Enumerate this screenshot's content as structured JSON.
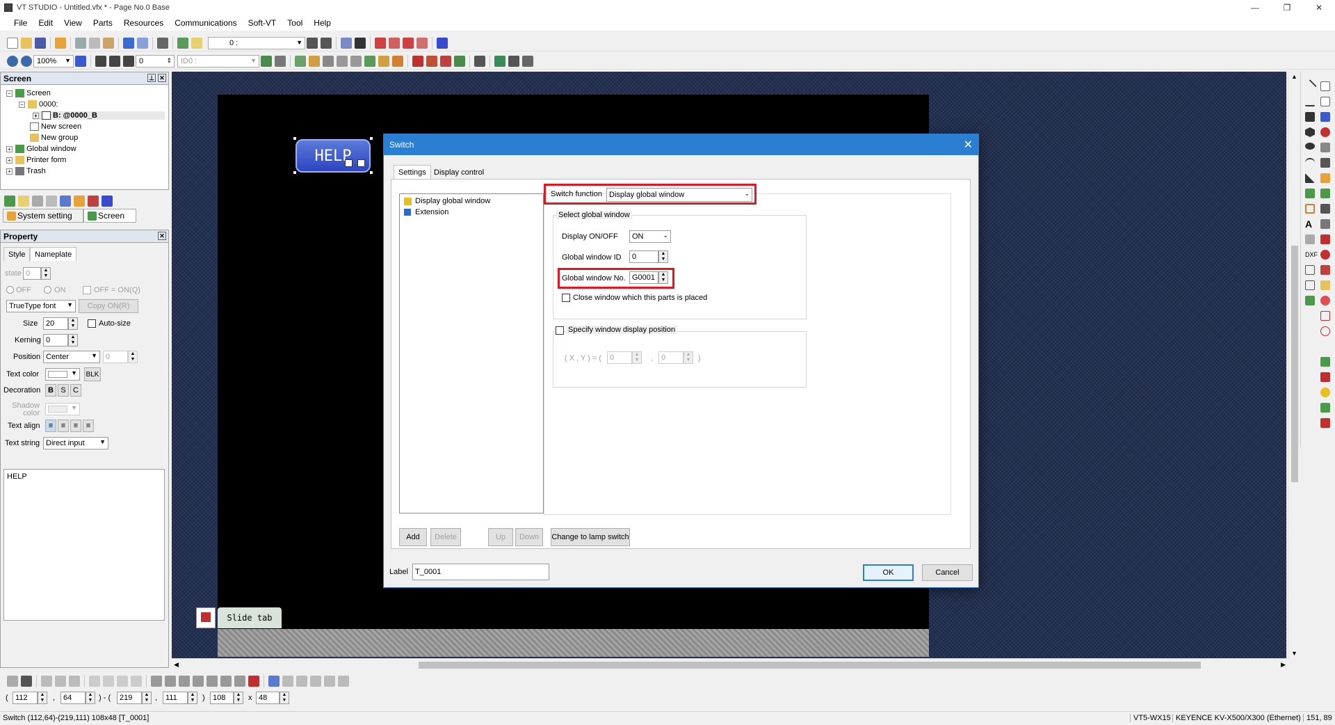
{
  "window": {
    "title": "VT STUDIO - Untitled.vfx * - Page No.0 Base",
    "controls": [
      "—",
      "❐",
      "✕"
    ]
  },
  "menu": [
    "File",
    "Edit",
    "View",
    "Parts",
    "Resources",
    "Communications",
    "Soft-VT",
    "Tool",
    "Help"
  ],
  "toolbar1": {
    "page_combo": "0 :"
  },
  "toolbar2": {
    "zoom": "100%",
    "layer": "0",
    "id_combo": "ID0 :"
  },
  "screen_panel": {
    "title": "Screen",
    "tree": [
      {
        "label": "Screen"
      },
      {
        "label": "0000:"
      },
      {
        "label": "B: @0000_B"
      },
      {
        "label": "New screen"
      },
      {
        "label": "New group"
      },
      {
        "label": "Global window"
      },
      {
        "label": "Printer form"
      },
      {
        "label": "Trash"
      }
    ],
    "tabs": {
      "system": "System setting",
      "screen": "Screen"
    }
  },
  "property_panel": {
    "title": "Property",
    "tabs": {
      "style": "Style",
      "nameplate": "Nameplate"
    },
    "state_label": "state",
    "state_value": "0",
    "radio_off": "OFF",
    "radio_on": "ON",
    "off_eq_on": "OFF = ON(Q)",
    "font": "TrueType font",
    "copy_btn": "Copy ON(R)",
    "size_label": "Size",
    "size_value": "20",
    "autosize": "Auto-size",
    "kerning_label": "Kerning",
    "kerning_value": "0",
    "position_label": "Position",
    "position_value": "Center",
    "position_num": "0",
    "textcolor_label": "Text color",
    "blk": "BLK",
    "decoration_label": "Decoration",
    "deco_b": "B",
    "deco_s": "S",
    "deco_c": "C",
    "shadow_label": "Shadow color",
    "textalign_label": "Text align",
    "textstring_label": "Text string",
    "textstring_value": "Direct input",
    "text_content": "HELP"
  },
  "canvas": {
    "help_button": "HELP",
    "slide_tab": "Slide tab"
  },
  "dialog": {
    "title": "Switch",
    "tabs": {
      "settings": "Settings",
      "display_control": "Display control"
    },
    "list": [
      "Display global window",
      "Extension"
    ],
    "switch_function_label": "Switch function",
    "switch_function_value": "Display global window",
    "group_title": "Select global window",
    "display_onoff_label": "Display ON/OFF",
    "display_onoff_value": "ON",
    "gw_id_label": "Global window ID",
    "gw_id_value": "0",
    "gw_no_label": "Global window No.",
    "gw_no_value": "G0001",
    "close_window": "Close window which this parts is placed",
    "specify_position": "Specify window display position",
    "xy_label": "( X , Y ) = (",
    "x_value": "0",
    "comma": ",",
    "y_value": "0",
    "close_paren": ")",
    "buttons": {
      "add": "Add",
      "delete": "Delete",
      "up": "Up",
      "down": "Down",
      "change": "Change to lamp switch",
      "ok": "OK",
      "cancel": "Cancel"
    },
    "label_caption": "Label",
    "label_value": "T_0001"
  },
  "coords": {
    "open1": "(",
    "x1": "112",
    "c1": ",",
    "y1": "64",
    "mid": ") - (",
    "x2": "219",
    "c2": ",",
    "y2": "111",
    "close": ")",
    "w": "108",
    "x": "x",
    "h": "48"
  },
  "status": {
    "left": "Switch (112,64)-(219,111) 108x48 [T_0001]",
    "model": "VT5-WX15",
    "plc": "KEYENCE KV-X500/X300 (Ethernet)",
    "pos": "151, 89"
  },
  "colors": {
    "accent": "#2b7fd3",
    "highlight": "#e8141e",
    "canvas_bg": "#1e2a4a"
  }
}
